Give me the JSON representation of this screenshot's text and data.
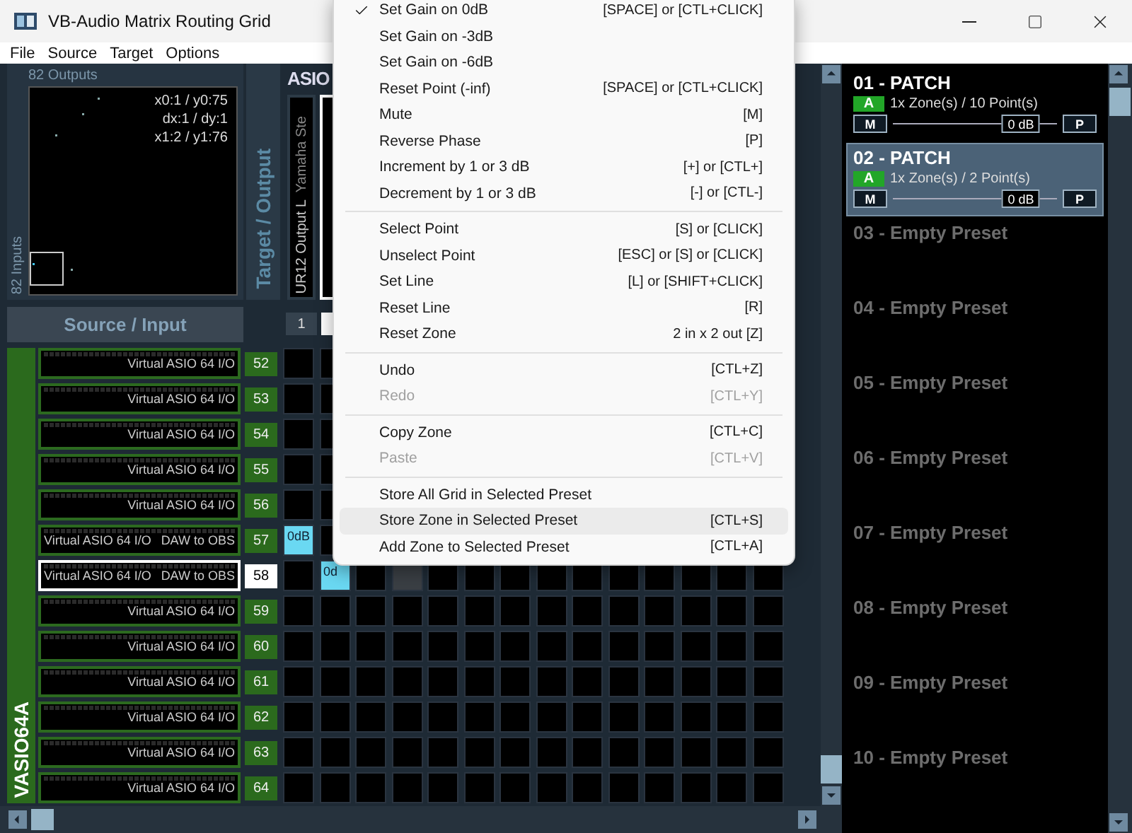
{
  "window": {
    "title": "VB-Audio Matrix Routing Grid"
  },
  "menu_bar": [
    "File",
    "Source",
    "Target",
    "Options"
  ],
  "overview": {
    "outputs_label": "82 Outputs",
    "inputs_label": "82 Inputs",
    "coords": [
      "x0:1 / y0:75",
      "dx:1 / dy:1",
      "x1:2 / y1:76"
    ]
  },
  "target_label": "Target / Output",
  "source_label": "Source / Input",
  "device_group": "VASIO64A",
  "target_device": "ASIO",
  "target_columns": [
    {
      "number": "1",
      "name": "UR12 Output L",
      "device": "Yamaha Ste",
      "selected": false
    },
    {
      "selected": true
    }
  ],
  "rows": [
    {
      "number": "52",
      "device": "Virtual ASIO 64 I/O",
      "selected": false,
      "cells": [
        {
          "kind": "empty"
        },
        {
          "kind": "empty"
        }
      ]
    },
    {
      "number": "53",
      "device": "Virtual ASIO 64 I/O",
      "selected": false,
      "cells": [
        {
          "kind": "empty"
        },
        {
          "kind": "empty"
        }
      ]
    },
    {
      "number": "54",
      "device": "Virtual ASIO 64 I/O",
      "selected": false,
      "cells": [
        {
          "kind": "empty"
        },
        {
          "kind": "empty"
        }
      ]
    },
    {
      "number": "55",
      "device": "Virtual ASIO 64 I/O",
      "selected": false,
      "cells": [
        {
          "kind": "empty"
        },
        {
          "kind": "empty"
        }
      ]
    },
    {
      "number": "56",
      "device": "Virtual ASIO 64 I/O",
      "selected": false,
      "cells": [
        {
          "kind": "empty"
        },
        {
          "kind": "empty"
        }
      ]
    },
    {
      "number": "57",
      "device": "Virtual ASIO 64 I/O",
      "label": "DAW to OBS",
      "selected": false,
      "cells": [
        {
          "kind": "point",
          "label": "0dB"
        },
        {
          "kind": "empty"
        }
      ]
    },
    {
      "number": "58",
      "device": "Virtual ASIO 64 I/O",
      "label": "DAW to OBS",
      "selected": true,
      "cells": [
        {
          "kind": "empty"
        },
        {
          "kind": "point",
          "label": "0d"
        },
        {
          "kind": "empty"
        },
        {
          "kind": "marked"
        },
        {
          "kind": "empty"
        },
        {
          "kind": "empty"
        },
        {
          "kind": "empty"
        },
        {
          "kind": "empty"
        },
        {
          "kind": "empty"
        },
        {
          "kind": "empty"
        },
        {
          "kind": "empty"
        },
        {
          "kind": "empty"
        },
        {
          "kind": "empty"
        },
        {
          "kind": "empty"
        }
      ]
    },
    {
      "number": "59",
      "device": "Virtual ASIO 64 I/O",
      "selected": false,
      "cells": [
        {
          "kind": "empty"
        },
        {
          "kind": "empty"
        },
        {
          "kind": "empty"
        },
        {
          "kind": "empty"
        },
        {
          "kind": "empty"
        },
        {
          "kind": "empty"
        },
        {
          "kind": "empty"
        },
        {
          "kind": "empty"
        },
        {
          "kind": "empty"
        },
        {
          "kind": "empty"
        },
        {
          "kind": "empty"
        },
        {
          "kind": "empty"
        },
        {
          "kind": "empty"
        },
        {
          "kind": "empty"
        }
      ]
    },
    {
      "number": "60",
      "device": "Virtual ASIO 64 I/O",
      "selected": false,
      "cells": [
        {
          "kind": "empty"
        },
        {
          "kind": "empty"
        },
        {
          "kind": "empty"
        },
        {
          "kind": "empty"
        },
        {
          "kind": "empty"
        },
        {
          "kind": "empty"
        },
        {
          "kind": "empty"
        },
        {
          "kind": "empty"
        },
        {
          "kind": "empty"
        },
        {
          "kind": "empty"
        },
        {
          "kind": "empty"
        },
        {
          "kind": "empty"
        },
        {
          "kind": "empty"
        },
        {
          "kind": "empty"
        }
      ]
    },
    {
      "number": "61",
      "device": "Virtual ASIO 64 I/O",
      "selected": false,
      "cells": [
        {
          "kind": "empty"
        },
        {
          "kind": "empty"
        },
        {
          "kind": "empty"
        },
        {
          "kind": "empty"
        },
        {
          "kind": "empty"
        },
        {
          "kind": "empty"
        },
        {
          "kind": "empty"
        },
        {
          "kind": "empty"
        },
        {
          "kind": "empty"
        },
        {
          "kind": "empty"
        },
        {
          "kind": "empty"
        },
        {
          "kind": "empty"
        },
        {
          "kind": "empty"
        },
        {
          "kind": "empty"
        }
      ]
    },
    {
      "number": "62",
      "device": "Virtual ASIO 64 I/O",
      "selected": false,
      "cells": [
        {
          "kind": "empty"
        },
        {
          "kind": "empty"
        },
        {
          "kind": "empty"
        },
        {
          "kind": "empty"
        },
        {
          "kind": "empty"
        },
        {
          "kind": "empty"
        },
        {
          "kind": "empty"
        },
        {
          "kind": "empty"
        },
        {
          "kind": "empty"
        },
        {
          "kind": "empty"
        },
        {
          "kind": "empty"
        },
        {
          "kind": "empty"
        },
        {
          "kind": "empty"
        },
        {
          "kind": "empty"
        }
      ]
    },
    {
      "number": "63",
      "device": "Virtual ASIO 64 I/O",
      "selected": false,
      "cells": [
        {
          "kind": "empty"
        },
        {
          "kind": "empty"
        },
        {
          "kind": "empty"
        },
        {
          "kind": "empty"
        },
        {
          "kind": "empty"
        },
        {
          "kind": "empty"
        },
        {
          "kind": "empty"
        },
        {
          "kind": "empty"
        },
        {
          "kind": "empty"
        },
        {
          "kind": "empty"
        },
        {
          "kind": "empty"
        },
        {
          "kind": "empty"
        },
        {
          "kind": "empty"
        },
        {
          "kind": "empty"
        }
      ]
    },
    {
      "number": "64",
      "device": "Virtual ASIO 64 I/O",
      "selected": false,
      "cells": [
        {
          "kind": "empty"
        },
        {
          "kind": "empty"
        },
        {
          "kind": "empty"
        },
        {
          "kind": "empty"
        },
        {
          "kind": "empty"
        },
        {
          "kind": "empty"
        },
        {
          "kind": "empty"
        },
        {
          "kind": "empty"
        },
        {
          "kind": "empty"
        },
        {
          "kind": "empty"
        },
        {
          "kind": "empty"
        },
        {
          "kind": "empty"
        },
        {
          "kind": "empty"
        },
        {
          "kind": "empty"
        }
      ]
    }
  ],
  "presets": [
    {
      "kind": "patch",
      "title": "01 - PATCH",
      "selected": false,
      "badge": "A",
      "info": "1x Zone(s) / 10 Point(s)",
      "mute": "M",
      "gain": "0 dB",
      "level": 0.78,
      "phase": "P"
    },
    {
      "kind": "patch",
      "title": "02 - PATCH",
      "selected": true,
      "badge": "A",
      "info": "1x Zone(s) / 2 Point(s)",
      "mute": "M",
      "gain": "0 dB",
      "level": 0.78,
      "phase": "P"
    },
    {
      "kind": "empty",
      "title": "03 - Empty Preset",
      "selected": false
    },
    {
      "kind": "empty",
      "title": "04 - Empty Preset",
      "selected": false
    },
    {
      "kind": "empty",
      "title": "05 - Empty Preset",
      "selected": false
    },
    {
      "kind": "empty",
      "title": "06 - Empty Preset",
      "selected": false
    },
    {
      "kind": "empty",
      "title": "07 - Empty Preset",
      "selected": false
    },
    {
      "kind": "empty",
      "title": "08 - Empty Preset",
      "selected": false
    },
    {
      "kind": "empty",
      "title": "09 - Empty Preset",
      "selected": false
    },
    {
      "kind": "empty",
      "title": "10 - Empty Preset",
      "selected": false
    }
  ],
  "context_menu": [
    {
      "kind": "item",
      "label": "Set Gain on 0dB",
      "shortcut": "[SPACE] or [CTL+CLICK]",
      "checked": true,
      "disabled": false,
      "selected": false
    },
    {
      "kind": "item",
      "label": "Set Gain on -3dB",
      "checked": false,
      "disabled": false,
      "selected": false
    },
    {
      "kind": "item",
      "label": "Set Gain on -6dB",
      "checked": false,
      "disabled": false,
      "selected": false
    },
    {
      "kind": "item",
      "label": "Reset Point (-inf)",
      "shortcut": "[SPACE] or [CTL+CLICK]",
      "checked": false,
      "disabled": false,
      "selected": false
    },
    {
      "kind": "item",
      "label": "Mute",
      "shortcut": "[M]",
      "checked": false,
      "disabled": false,
      "selected": false
    },
    {
      "kind": "item",
      "label": "Reverse Phase",
      "shortcut": "[P]",
      "checked": false,
      "disabled": false,
      "selected": false
    },
    {
      "kind": "item",
      "label": "Increment by 1 or 3 dB",
      "shortcut": "[+] or [CTL+]",
      "checked": false,
      "disabled": false,
      "selected": false
    },
    {
      "kind": "item",
      "label": "Decrement by 1 or 3 dB",
      "shortcut": "[-] or [CTL-]",
      "checked": false,
      "disabled": false,
      "selected": false
    },
    {
      "kind": "separator"
    },
    {
      "kind": "item",
      "label": "Select Point",
      "shortcut": "[S] or [CLICK]",
      "checked": false,
      "disabled": false,
      "selected": false
    },
    {
      "kind": "item",
      "label": "Unselect Point",
      "shortcut": "[ESC] or [S] or [CLICK]",
      "checked": false,
      "disabled": false,
      "selected": false
    },
    {
      "kind": "item",
      "label": "Set Line",
      "shortcut": "[L] or [SHIFT+CLICK]",
      "checked": false,
      "disabled": false,
      "selected": false
    },
    {
      "kind": "item",
      "label": "Reset Line",
      "shortcut": "[R]",
      "checked": false,
      "disabled": false,
      "selected": false
    },
    {
      "kind": "item",
      "label": "Reset Zone",
      "shortcut": "2 in x 2 out [Z]",
      "checked": false,
      "disabled": false,
      "selected": false
    },
    {
      "kind": "separator"
    },
    {
      "kind": "item",
      "label": "Undo",
      "shortcut": "[CTL+Z]",
      "checked": false,
      "disabled": false,
      "selected": false
    },
    {
      "kind": "item",
      "label": "Redo",
      "shortcut": "[CTL+Y]",
      "checked": false,
      "disabled": true,
      "selected": false
    },
    {
      "kind": "separator"
    },
    {
      "kind": "item",
      "label": "Copy Zone",
      "shortcut": "[CTL+C]",
      "checked": false,
      "disabled": false,
      "selected": false
    },
    {
      "kind": "item",
      "label": "Paste",
      "shortcut": "[CTL+V]",
      "checked": false,
      "disabled": true,
      "selected": false
    },
    {
      "kind": "separator"
    },
    {
      "kind": "item",
      "label": "Store All Grid in Selected Preset",
      "checked": false,
      "disabled": false,
      "selected": false
    },
    {
      "kind": "item",
      "label": "Store Zone in Selected Preset",
      "shortcut": "[CTL+S]",
      "checked": false,
      "disabled": false,
      "selected": true
    },
    {
      "kind": "item",
      "label": "Add Zone to Selected Preset",
      "shortcut": "[CTL+A]",
      "checked": false,
      "disabled": false,
      "selected": false
    }
  ]
}
